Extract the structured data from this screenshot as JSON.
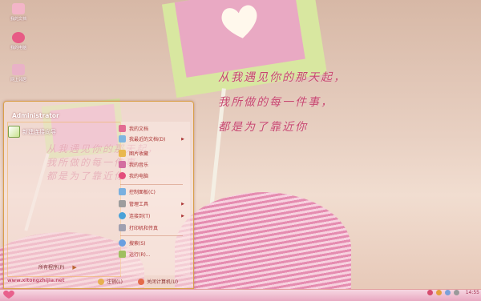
{
  "desktop_icons": [
    {
      "label": "我的文档",
      "color": "#f3b5c8"
    },
    {
      "label": "我的电脑",
      "color": "#e75b85"
    },
    {
      "label": "网上邻居",
      "color": "#e9b2c7"
    }
  ],
  "poem": [
    "从我遇见你的那天起，",
    "我所做的每一件事，",
    "都是为了靠近你"
  ],
  "start_menu": {
    "user": "Administrator",
    "pinned_label": "新建连接向导",
    "right_items": [
      {
        "label": "我的文档",
        "icon": "documents-icon",
        "color": "#e26d93"
      },
      {
        "label": "我最近的文档(D)",
        "icon": "recent-docs-icon",
        "color": "#7fb6e0",
        "submenu": true
      },
      {
        "label": "图片收藏",
        "icon": "pictures-icon",
        "color": "#e9b84f"
      },
      {
        "label": "我的音乐",
        "icon": "music-icon",
        "color": "#d36ea0"
      },
      {
        "label": "我的电脑",
        "icon": "computer-icon",
        "color": "#e34e7c"
      },
      {
        "label": "控制面板(C)",
        "icon": "control-panel-icon",
        "color": "#7ab0df"
      },
      {
        "label": "管理工具",
        "icon": "admin-tools-icon",
        "color": "#9d9d9d",
        "submenu": true
      },
      {
        "label": "连接到(T)",
        "icon": "connect-icon",
        "color": "#4aa2d8",
        "submenu": true
      },
      {
        "label": "打印机和传真",
        "icon": "printer-icon",
        "color": "#a0a0b0"
      },
      {
        "label": "搜索(S)",
        "icon": "search-icon",
        "color": "#6a9fe0"
      },
      {
        "label": "运行(R)...",
        "icon": "run-icon",
        "color": "#9fbf5f"
      }
    ],
    "all_programs": "所有程序(P)",
    "website": "www.xitongzhijia.net",
    "logoff": "注销(L)",
    "shutdown": "关闭计算机(U)"
  },
  "taskbar": {
    "clock": "14:55"
  },
  "colors": {
    "accent": "#c6486d",
    "menu_border": "#d9a04a",
    "taskbar": "#f0bfd1"
  }
}
